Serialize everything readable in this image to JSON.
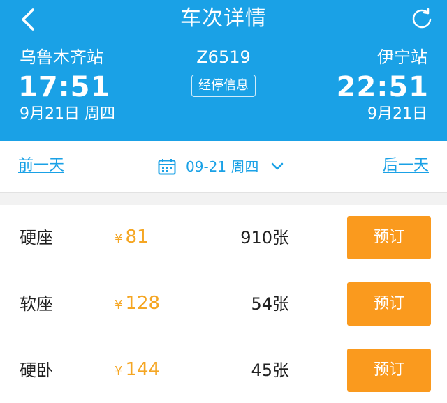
{
  "header": {
    "title": "车次详情",
    "back_icon": "chevron-left-icon",
    "refresh_icon": "refresh-icon",
    "background_color": "#1aa1e6"
  },
  "trip": {
    "train_number": "Z6519",
    "stop_info_label": "经停信息",
    "departure": {
      "station": "乌鲁木齐站",
      "time": "17:51",
      "date": "9月21日 周四"
    },
    "arrival": {
      "station": "伊宁站",
      "time": "22:51",
      "date": "9月21日"
    }
  },
  "date_bar": {
    "prev_label": "前一天",
    "next_label": "后一天",
    "current_date": "09-21 周四",
    "calendar_icon": "calendar-icon",
    "dropdown_icon": "chevron-down-icon",
    "accent_color": "#1aa1e6"
  },
  "seats": [
    {
      "type": "硬座",
      "currency": "¥",
      "price": "81",
      "tickets": "910张",
      "book_label": "预订"
    },
    {
      "type": "软座",
      "currency": "¥",
      "price": "128",
      "tickets": "54张",
      "book_label": "预订"
    },
    {
      "type": "硬卧",
      "currency": "¥",
      "price": "144",
      "tickets": "45张",
      "book_label": "预订"
    }
  ],
  "colors": {
    "price": "#f5a623",
    "book_button": "#fa9a1e"
  }
}
